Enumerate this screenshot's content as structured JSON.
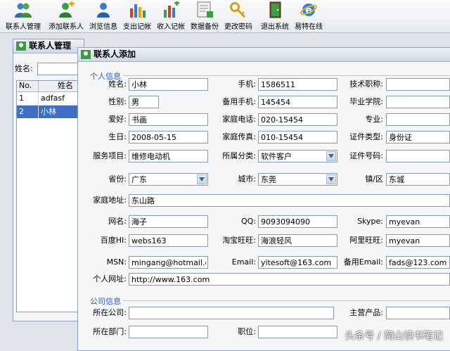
{
  "toolbar": {
    "items": [
      {
        "label": "联系人管理",
        "icon": "users-icon"
      },
      {
        "label": "添加联系人",
        "icon": "add-user-icon"
      },
      {
        "label": "浏览信息",
        "icon": "browse-icon"
      },
      {
        "label": "支出记帐",
        "icon": "expense-chart-icon"
      },
      {
        "label": "收入记帐",
        "icon": "income-chart-icon"
      },
      {
        "label": "数据备份",
        "icon": "backup-icon"
      },
      {
        "label": "更改密码",
        "icon": "key-icon"
      },
      {
        "label": "退出系统",
        "icon": "exit-icon"
      },
      {
        "label": "易特在线",
        "icon": "ie-icon"
      }
    ]
  },
  "manager_window": {
    "title": "联系人管理",
    "name_label": "姓名:",
    "columns": [
      "No.",
      "姓名"
    ],
    "rows": [
      {
        "no": "1",
        "name": "adfasf"
      },
      {
        "no": "2",
        "name": "小林"
      }
    ],
    "selected_row": 1
  },
  "add_window": {
    "title": "联系人添加",
    "personal_group": "个人信息",
    "fields": {
      "name": {
        "label": "姓名:",
        "value": "小林"
      },
      "mobile": {
        "label": "手机:",
        "value": "1586511"
      },
      "title": {
        "label": "技术职称:",
        "value": ""
      },
      "gender": {
        "label": "性别:",
        "value": "男"
      },
      "mobile2": {
        "label": "备用手机:",
        "value": "145454"
      },
      "school": {
        "label": "毕业学院:",
        "value": ""
      },
      "hobby": {
        "label": "爱好:",
        "value": "书画"
      },
      "home_tel": {
        "label": "家庭电话:",
        "value": "020-15454"
      },
      "major": {
        "label": "专业:",
        "value": ""
      },
      "birthday": {
        "label": "生日:",
        "value": "2008-05-15"
      },
      "home_fax": {
        "label": "家庭传真:",
        "value": "010-15454"
      },
      "id_type": {
        "label": "证件类型:",
        "value": "身份证"
      },
      "service": {
        "label": "服务项目:",
        "value": "维修电动机"
      },
      "category": {
        "label": "所属分类:",
        "value": "软件客户"
      },
      "id_number": {
        "label": "证件号码:",
        "value": ""
      },
      "province": {
        "label": "省份:",
        "value": "广东"
      },
      "city": {
        "label": "城市:",
        "value": "东莞"
      },
      "town": {
        "label": "镇/区",
        "value": "东城"
      },
      "address": {
        "label": "家庭地址:",
        "value": "东山路"
      },
      "nickname": {
        "label": "网名:",
        "value": "海子"
      },
      "qq": {
        "label": "QQ:",
        "value": "9093094090"
      },
      "skype": {
        "label": "Skype:",
        "value": "myevan"
      },
      "baidu": {
        "label": "百度HI:",
        "value": "webs163"
      },
      "taobao": {
        "label": "淘宝旺旺:",
        "value": "海浪轻风"
      },
      "aliww": {
        "label": "阿里旺旺:",
        "value": "myevan"
      },
      "msn": {
        "label": "MSN:",
        "value": "mingang@hotmail.com"
      },
      "email": {
        "label": "Email:",
        "value": "yitesoft@163.com"
      },
      "email2": {
        "label": "备用Email:",
        "value": "fads@123.com"
      },
      "website": {
        "label": "个人网址:",
        "value": "http://www.163.com"
      }
    },
    "company_group": "公司信息",
    "company": {
      "company": {
        "label": "所在公司:",
        "value": ""
      },
      "product": {
        "label": "主营产品:",
        "value": ""
      },
      "dept": {
        "label": "所在部门:",
        "value": ""
      },
      "position": {
        "label": "职位:",
        "value": ""
      }
    }
  },
  "watermark": "头条号 / 简山读书笔记",
  "colors": {
    "accent": "#2f5fae",
    "selection": "#3d6fc6"
  }
}
